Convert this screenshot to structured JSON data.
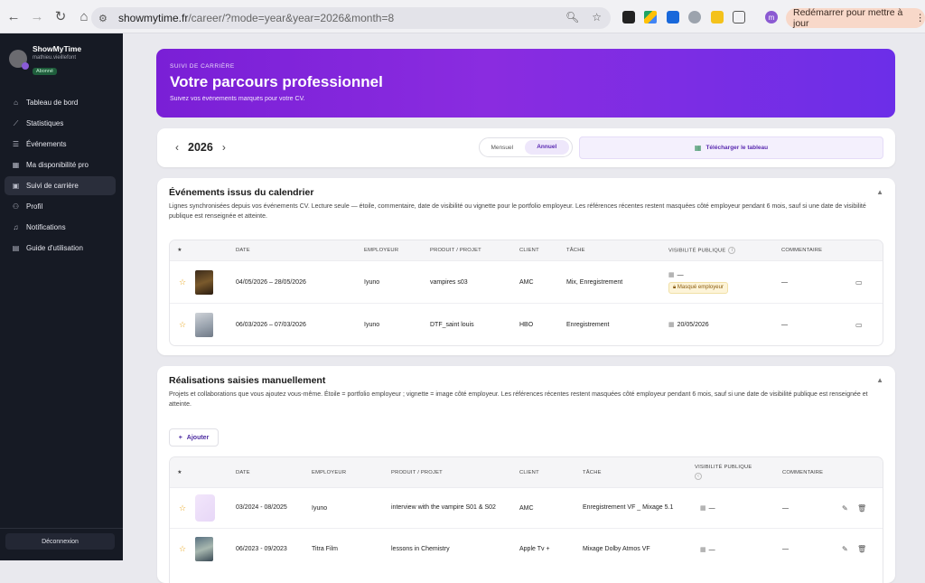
{
  "browser": {
    "url_host": "showmytime.fr",
    "url_path": "/career/?mode=year&year=2026&month=8",
    "update_label": "Redémarrer pour mettre à jour",
    "profile_initial": "m"
  },
  "sidebar": {
    "app_name": "ShowMyTime",
    "user_email": "mathieu.vieillefont",
    "badge": "Abonné",
    "items": [
      {
        "label": "Tableau de bord",
        "icon": "home-icon"
      },
      {
        "label": "Statistiques",
        "icon": "chart-icon"
      },
      {
        "label": "Événements",
        "icon": "list-icon"
      },
      {
        "label": "Ma disponibilité pro",
        "icon": "calendar-icon"
      },
      {
        "label": "Suivi de carrière",
        "icon": "briefcase-icon"
      },
      {
        "label": "Profil",
        "icon": "user-icon"
      },
      {
        "label": "Notifications",
        "icon": "bell-icon"
      },
      {
        "label": "Guide d'utilisation",
        "icon": "book-icon"
      }
    ],
    "logout": "Déconnexion"
  },
  "hero": {
    "eyebrow": "SUIVI DE CARRIÈRE",
    "title": "Votre parcours professionnel",
    "subtitle": "Suivez vos événements marqués pour votre CV."
  },
  "yearbar": {
    "year": "2026",
    "toggle_monthly": "Mensuel",
    "toggle_yearly": "Annuel",
    "download": "Télécharger le tableau"
  },
  "calendar_section": {
    "title": "Événements issus du calendrier",
    "description": "Lignes synchronisées depuis vos événements CV. Lecture seule — étoile, commentaire, date de visibilité ou vignette pour le portfolio employeur. Les références récentes restent masquées côté employeur pendant 6 mois, sauf si une date de visibilité publique est renseignée et atteinte.",
    "headers": {
      "star": "★",
      "date": "DATE",
      "employer": "EMPLOYEUR",
      "product": "PRODUIT / PROJET",
      "client": "CLIENT",
      "task": "TÂCHE",
      "visibility": "VISIBILITÉ PUBLIQUE",
      "comment": "COMMENTAIRE"
    },
    "rows": [
      {
        "date": "04/05/2026 – 28/05/2026",
        "employer": "Iyuno",
        "product": "vampires s03",
        "client": "AMC",
        "task": "Mix, Enregistrement",
        "visibility": "—",
        "mask": "Masqué employeur",
        "comment": "—"
      },
      {
        "date": "06/03/2026 – 07/03/2026",
        "employer": "Iyuno",
        "product": "DTF_saint louis",
        "client": "HBO",
        "task": "Enregistrement",
        "visibility": "20/05/2026",
        "mask": "",
        "comment": "—"
      }
    ]
  },
  "manual_section": {
    "title": "Réalisations saisies manuellement",
    "description": "Projets et collaborations que vous ajoutez vous-même. Étoile = portfolio employeur ; vignette = image côté employeur. Les références récentes restent masquées côté employeur pendant 6 mois, sauf si une date de visibilité publique est renseignée et atteinte.",
    "add_label": "Ajouter",
    "headers": {
      "star": "★",
      "date": "DATE",
      "employer": "EMPLOYEUR",
      "product": "PRODUIT / PROJET",
      "client": "CLIENT",
      "task": "TÂCHE",
      "visibility": "VISIBILITÉ PUBLIQUE",
      "comment": "COMMENTAIRE"
    },
    "rows": [
      {
        "date": "03/2024 - 08/2025",
        "employer": "Iyuno",
        "product": "interview with the vampire S01 & S02",
        "client": "AMC",
        "task": "Enregistrement VF _ Mixage 5.1",
        "visibility": "—",
        "comment": "—"
      },
      {
        "date": "06/2023 - 09/2023",
        "employer": "Titra Film",
        "product": "lessons in Chemistry",
        "client": "Apple Tv +",
        "task": "Mixage Dolby Atmos VF",
        "visibility": "—",
        "comment": "—"
      }
    ]
  }
}
